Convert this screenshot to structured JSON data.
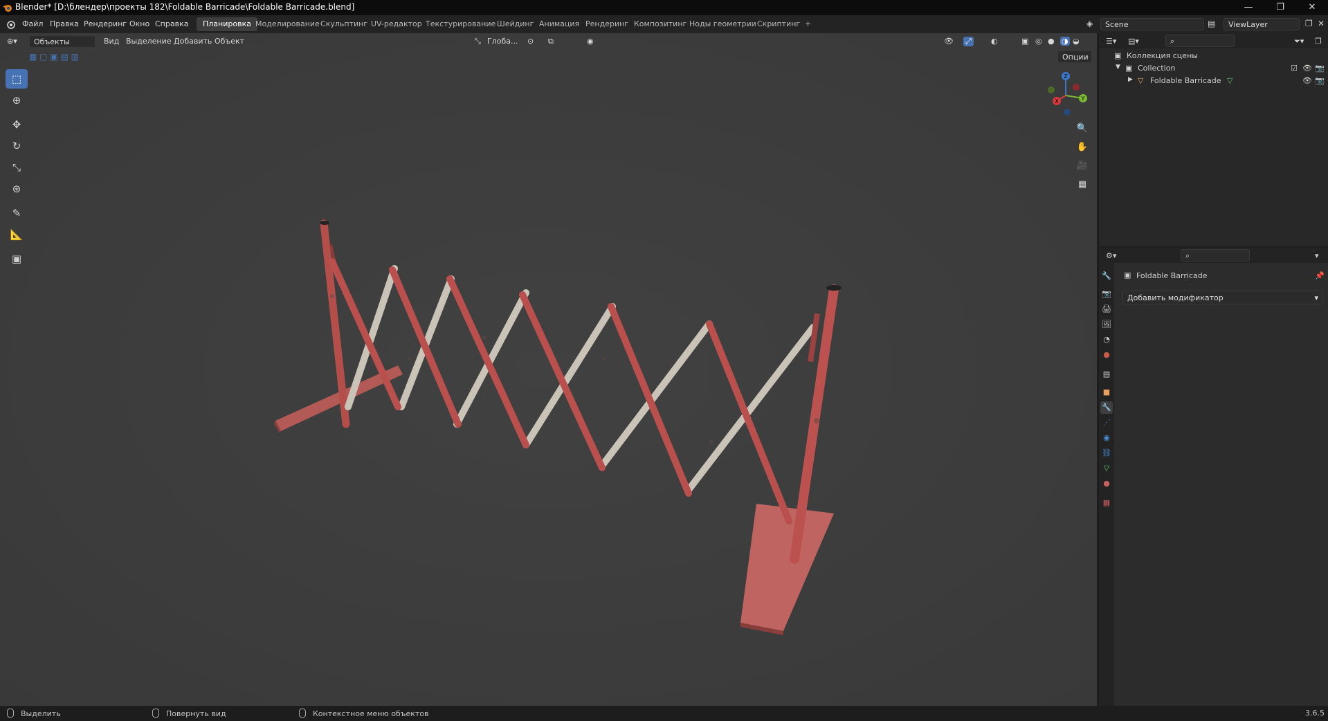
{
  "window": {
    "title": "Blender* [D:\\блендер\\проекты 182\\Foldable Barricade\\Foldable Barricade.blend]",
    "controls": [
      "—",
      "❐",
      "✕"
    ]
  },
  "menu": [
    "Файл",
    "Правка",
    "Рендеринг",
    "Окно",
    "Справка"
  ],
  "workspaces": [
    "Планировка",
    "Моделирование",
    "Скульптинг",
    "UV-редактор",
    "Текстурирование",
    "Шейдинг",
    "Анимация",
    "Рендеринг",
    "Композитинг",
    "Ноды геометрии",
    "Скриптинг",
    "+"
  ],
  "active_workspace": "Планировка",
  "scene": {
    "label": "Scene",
    "view_layer": "ViewLayer"
  },
  "viewport_header": {
    "mode": "Объекты",
    "menus": [
      "Вид",
      "Выделение",
      "Добавить",
      "Объект"
    ],
    "transform_orientation": "Глоба...",
    "options": "Опции"
  },
  "gizmo_axes": {
    "x": "X",
    "y": "Y",
    "z": "Z"
  },
  "outliner": {
    "root": "Коллекция сцены",
    "collection": "Collection",
    "object": "Foldable Barricade"
  },
  "properties": {
    "object_name": "Foldable Barricade",
    "add_modifier": "Добавить модификатор"
  },
  "status": {
    "select": "Выделить",
    "rotate": "Повернуть вид",
    "context": "Контекстное меню объектов",
    "version": "3.6.5"
  },
  "colors": {
    "accent": "#4772b3",
    "barricade_red": "#b9504e",
    "barricade_white": "#c9c4bb",
    "viewport_bg": "#3d3d3d"
  }
}
